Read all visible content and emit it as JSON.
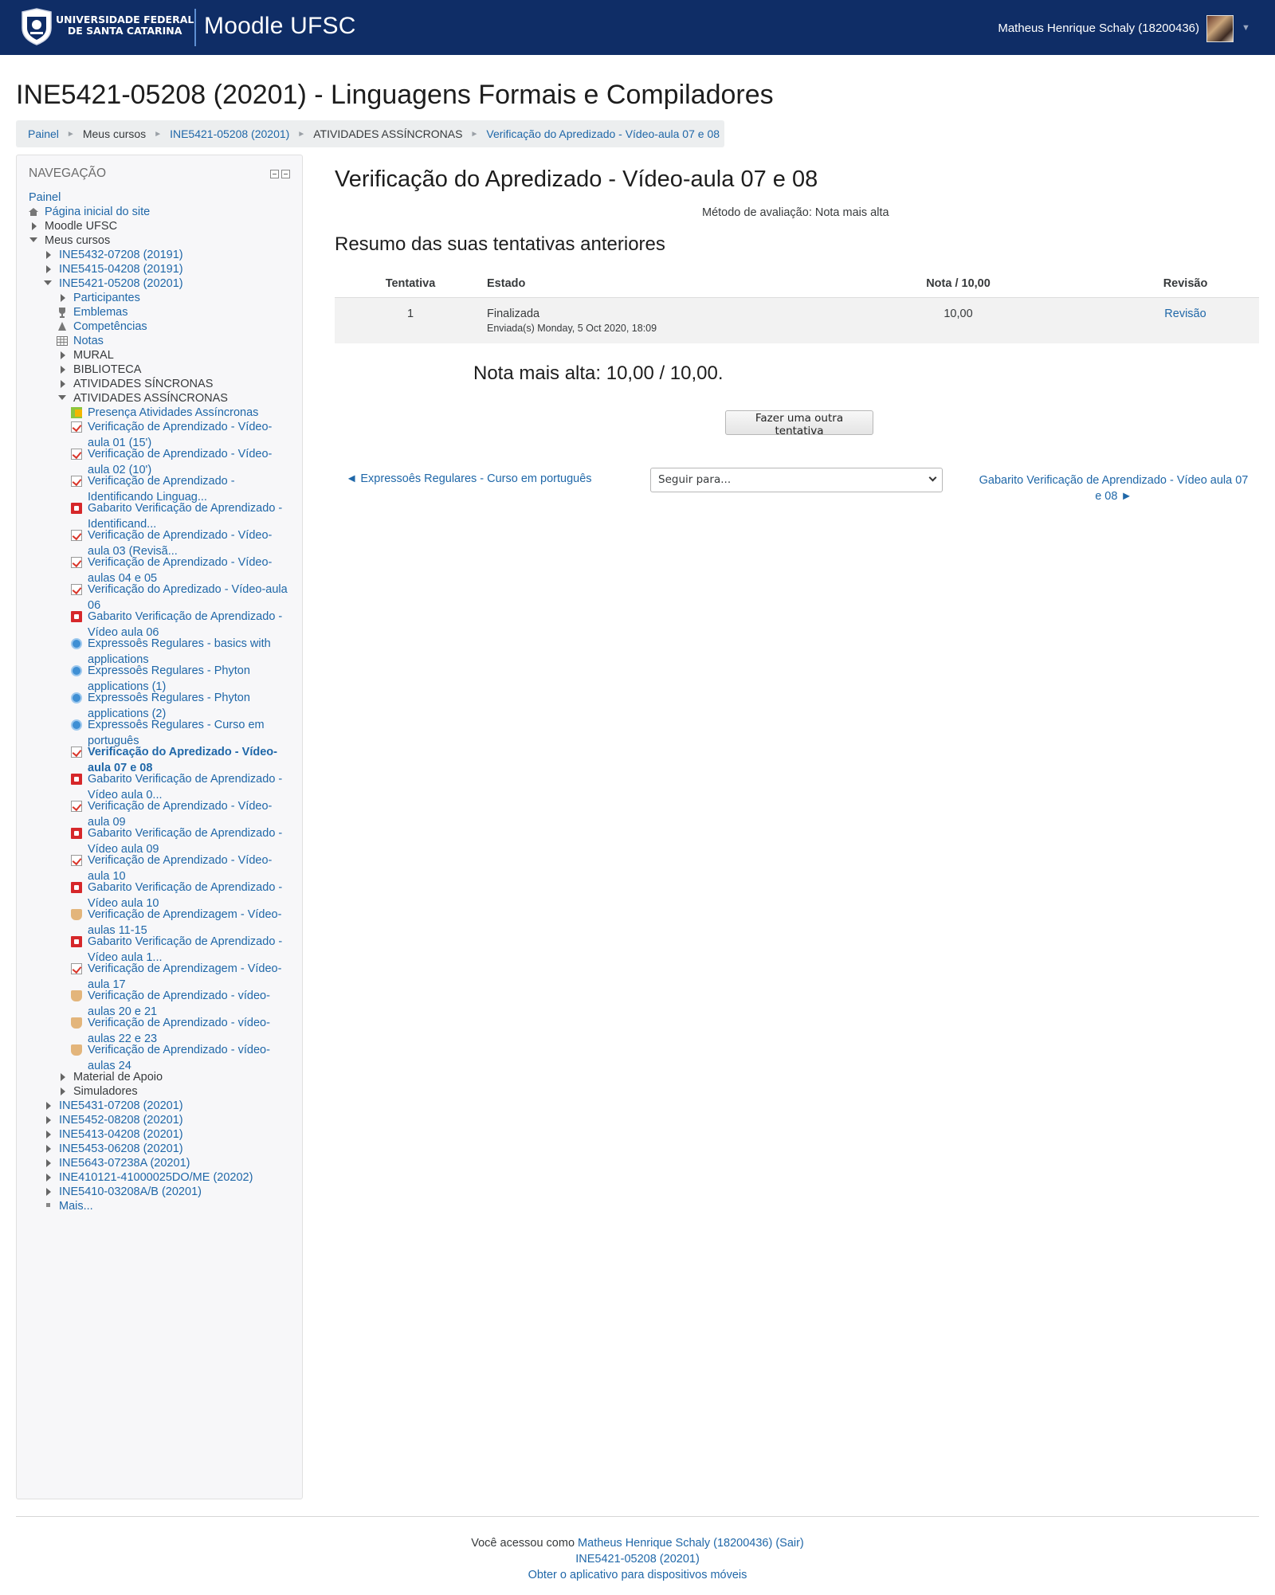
{
  "header": {
    "university_line1": "UNIVERSIDADE FEDERAL",
    "university_line2": "DE SANTA CATARINA",
    "site_name": "Moodle UFSC",
    "user_name": "Matheus Henrique Schaly (18200436)",
    "brand_color": "#0f2d66"
  },
  "page": {
    "heading": "INE5421-05208 (20201) - Linguagens Formais e Compiladores"
  },
  "breadcrumb": [
    {
      "label": "Painel"
    },
    {
      "label": "Meus cursos"
    },
    {
      "label": "INE5421-05208 (20201)"
    },
    {
      "label": "ATIVIDADES ASSÍNCRONAS"
    },
    {
      "label": "Verificação do Apredizado - Vídeo-aula 07 e 08"
    }
  ],
  "navigation": {
    "title": "NAVEGAÇÃO",
    "items": [
      {
        "label": "Painel"
      },
      {
        "label": "Página inicial do site"
      },
      {
        "label": "Moodle UFSC"
      },
      {
        "label": "Meus cursos"
      },
      {
        "label": "INE5432-07208 (20191)"
      },
      {
        "label": "INE5415-04208 (20191)"
      },
      {
        "label": "INE5421-05208 (20201)"
      },
      {
        "label": "Participantes"
      },
      {
        "label": "Emblemas"
      },
      {
        "label": "Competências"
      },
      {
        "label": "Notas"
      },
      {
        "label": "MURAL"
      },
      {
        "label": "BIBLIOTECA"
      },
      {
        "label": "ATIVIDADES SÍNCRONAS"
      },
      {
        "label": "ATIVIDADES ASSÍNCRONAS"
      },
      {
        "label": "Presença Atividades Assíncronas"
      },
      {
        "label": "Verificação de Aprendizado - Vídeo-aula 01 (15')"
      },
      {
        "label": "Verificação de Aprendizado - Vídeo-aula 02 (10')"
      },
      {
        "label": "Verificação de Aprendizado - Identificando Linguag..."
      },
      {
        "label": "Gabarito Verificação de Aprendizado - Identificand..."
      },
      {
        "label": "Verificação de Aprendizado - Vídeo-aula 03 (Revisã..."
      },
      {
        "label": "Verificação de Aprendizado - Vídeo-aulas 04 e 05"
      },
      {
        "label": "Verificação do Apredizado - Vídeo-aula 06"
      },
      {
        "label": "Gabarito Verificação de Aprendizado - Vídeo aula 06"
      },
      {
        "label": "Expressoês Regulares - basics with applications"
      },
      {
        "label": "Expressoês Regulares - Phyton applications (1)"
      },
      {
        "label": "Expressoês Regulares - Phyton applications (2)"
      },
      {
        "label": "Expressoês Regulares - Curso em português"
      },
      {
        "label": "Verificação do Apredizado - Vídeo-aula 07 e 08"
      },
      {
        "label": "Gabarito Verificação de Aprendizado - Vídeo aula 0..."
      },
      {
        "label": "Verificação de Aprendizado - Vídeo-aula 09"
      },
      {
        "label": "Gabarito Verificação de Aprendizado - Vídeo aula 09"
      },
      {
        "label": "Verificação de Aprendizado - Vídeo-aula 10"
      },
      {
        "label": "Gabarito Verificação de Aprendizado - Vídeo aula 10"
      },
      {
        "label": "Verificação de Aprendizagem - Vídeo-aulas 11-15"
      },
      {
        "label": "Gabarito Verificação de Aprendizado - Vídeo aula 1..."
      },
      {
        "label": "Verificação de Aprendizagem - Vídeo-aula 17"
      },
      {
        "label": "Verificação de Aprendizado - vídeo-aulas 20 e 21"
      },
      {
        "label": "Verificação de Aprendizado - vídeo-aulas 22 e 23"
      },
      {
        "label": "Verificação de Aprendizado - vídeo-aulas 24"
      },
      {
        "label": "Material de Apoio"
      },
      {
        "label": "Simuladores"
      },
      {
        "label": "INE5431-07208 (20201)"
      },
      {
        "label": "INE5452-08208 (20201)"
      },
      {
        "label": "INE5413-04208 (20201)"
      },
      {
        "label": "INE5453-06208 (20201)"
      },
      {
        "label": "INE5643-07238A (20201)"
      },
      {
        "label": "INE410121-41000025DO/ME (20202)"
      },
      {
        "label": "INE5410-03208A/B (20201)"
      },
      {
        "label": "Mais..."
      }
    ]
  },
  "main": {
    "title": "Verificação do Apredizado - Vídeo-aula 07 e 08",
    "grading_method": "Método de avaliação: Nota mais alta",
    "summary_title": "Resumo das suas tentativas anteriores",
    "table": {
      "headers": [
        "Tentativa",
        "Estado",
        "Nota / 10,00",
        "Revisão"
      ],
      "rows": [
        {
          "attempt": "1",
          "state": "Finalizada",
          "submitted": "Enviada(s) Monday, 5 Oct 2020, 18:09",
          "grade": "10,00",
          "review": "Revisão"
        }
      ]
    },
    "highest_grade": "Nota mais alta: 10,00 / 10,00.",
    "retry_button": "Fazer uma outra tentativa",
    "prev_activity": "◄ Expressoês Regulares - Curso em português",
    "jump_placeholder": "Seguir para...",
    "next_activity": "Gabarito Verificação de Aprendizado - Vídeo aula 07 e 08 ►"
  },
  "footer": {
    "logged_prefix": "Você acessou como ",
    "logged_user": "Matheus Henrique Schaly (18200436)",
    "logout": "(Sair)",
    "course_link": "INE5421-05208 (20201)",
    "mobile_app": "Obter o aplicativo para dispositivos móveis"
  }
}
